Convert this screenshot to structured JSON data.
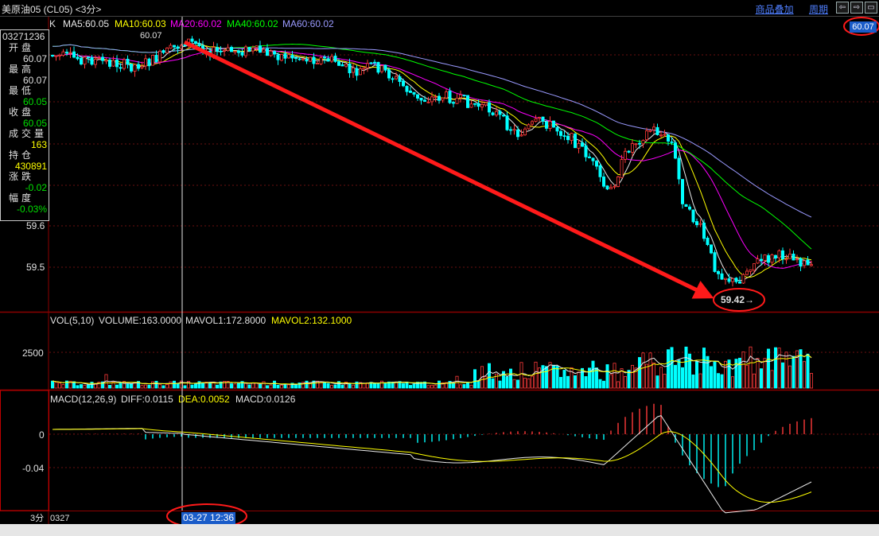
{
  "window": {
    "title": "美原油05 (CL05) <3分>",
    "links": [
      "商品叠加",
      "周期"
    ],
    "buttons": [
      "⇦",
      "⇨",
      "▭"
    ]
  },
  "price_badge": "60.07",
  "info_panel": {
    "code": "03271236",
    "rows": [
      {
        "label": "开盘",
        "value": "60.07",
        "color": "#e0e0e0"
      },
      {
        "label": "最高",
        "value": "60.07",
        "color": "#e0e0e0"
      },
      {
        "label": "最低",
        "value": "60.05",
        "color": "#00e000"
      },
      {
        "label": "收盘",
        "value": "60.05",
        "color": "#00e000"
      },
      {
        "label": "成交量",
        "value": "163",
        "color": "#ffff00"
      },
      {
        "label": "持仓",
        "value": "430891",
        "color": "#ffff00"
      },
      {
        "label": "涨跌",
        "value": "-0.02",
        "color": "#00e000"
      },
      {
        "label": "幅度",
        "value": "-0.03%",
        "color": "#00e000"
      }
    ]
  },
  "price_pane": {
    "k_label": "K",
    "ma": [
      {
        "text": "MA5:60.05",
        "color": "#e8e8e8"
      },
      {
        "text": "MA10:60.03",
        "color": "#ffff00"
      },
      {
        "text": "MA20:60.02",
        "color": "#ff00ff"
      },
      {
        "text": "MA40:60.02",
        "color": "#00ff00"
      },
      {
        "text": "MA60:60.02",
        "color": "#9a9aff"
      }
    ],
    "peak_label": "60.07",
    "low_label": "59.42→",
    "y_ticks": [
      "59.6",
      "59.5"
    ]
  },
  "volume_pane": {
    "label": "VOL(5,10)",
    "volume": "VOLUME:163.0000",
    "mavol1": "MAVOL1:172.8000",
    "mavol2": "MAVOL2:132.1000",
    "y_tick": "2500"
  },
  "macd_pane": {
    "label": "MACD(12,26,9)",
    "diff": "DIFF:0.0115",
    "dea": "DEA:0.0052",
    "macd": "MACD:0.0126",
    "y_ticks": [
      "0",
      "-0.04"
    ]
  },
  "axis": {
    "period": "3分",
    "date_start": "0327",
    "hover_time": "03-27 12:36"
  },
  "colors": {
    "up": "#ff3a3a",
    "down": "#00ffff",
    "ma5": "#e8e8e8",
    "ma10": "#ffff00",
    "ma20": "#ff00ff",
    "ma40": "#00ff00",
    "ma60": "#9a9aff",
    "annotation": "#ff1a1a",
    "highlight": "#1a5cc9"
  },
  "chart_data": {
    "type": "candlestick",
    "price_ticks": [
      59.5,
      59.6
    ],
    "series": [
      {
        "name": "MA5",
        "last": 60.05
      },
      {
        "name": "MA10",
        "last": 60.03
      },
      {
        "name": "MA20",
        "last": 60.02
      },
      {
        "name": "MA40",
        "last": 60.02
      },
      {
        "name": "MA60",
        "last": 60.02
      }
    ],
    "annotations": [
      {
        "type": "trend-arrow",
        "from": "60.07",
        "to": "59.42"
      },
      {
        "type": "circled-label",
        "value": "59.42"
      },
      {
        "type": "circled-label",
        "value": "60.07"
      },
      {
        "type": "circled-label",
        "value": "03-27 12:36"
      }
    ],
    "volume": {
      "last": 163.0,
      "mavol1": 172.8,
      "mavol2": 132.1
    },
    "macd": {
      "diff": 0.0115,
      "dea": 0.0052,
      "macd": 0.0126
    }
  }
}
